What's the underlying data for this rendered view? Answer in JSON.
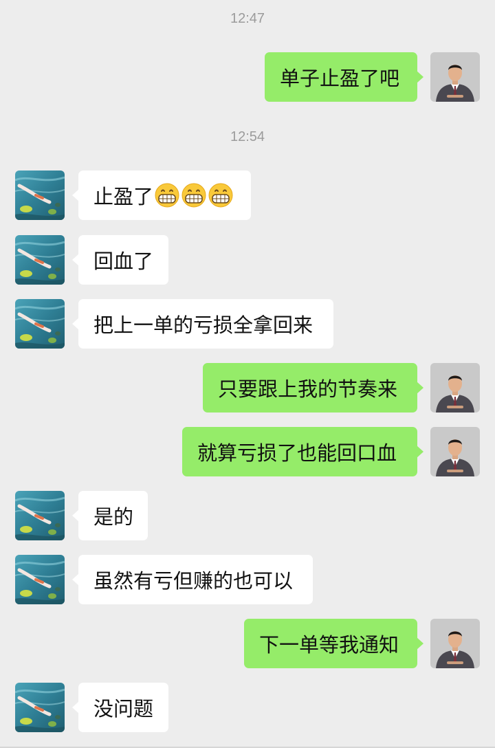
{
  "timestamps": [
    "12:47",
    "12:54"
  ],
  "messages": [
    {
      "side": "right",
      "text": "单子止盈了吧"
    },
    {
      "side": "left",
      "text": "止盈了",
      "emoji": [
        "grin-icon",
        "grin-icon",
        "grin-icon"
      ]
    },
    {
      "side": "left",
      "text": "回血了"
    },
    {
      "side": "left",
      "text": "把上一单的亏损全拿回来"
    },
    {
      "side": "right",
      "text": "只要跟上我的节奏来"
    },
    {
      "side": "right",
      "text": "就算亏损了也能回口血"
    },
    {
      "side": "left",
      "text": "是的"
    },
    {
      "side": "left",
      "text": "虽然有亏但赚的也可以"
    },
    {
      "side": "right",
      "text": "下一单等我通知"
    },
    {
      "side": "left",
      "text": "没问题"
    }
  ],
  "colors": {
    "background": "#ededed",
    "outgoing_bubble": "#95ec69",
    "incoming_bubble": "#ffffff",
    "timestamp_text": "#9b9b9b"
  },
  "avatars": {
    "left": "koi-pond-avatar",
    "right": "man-in-suit-avatar"
  }
}
